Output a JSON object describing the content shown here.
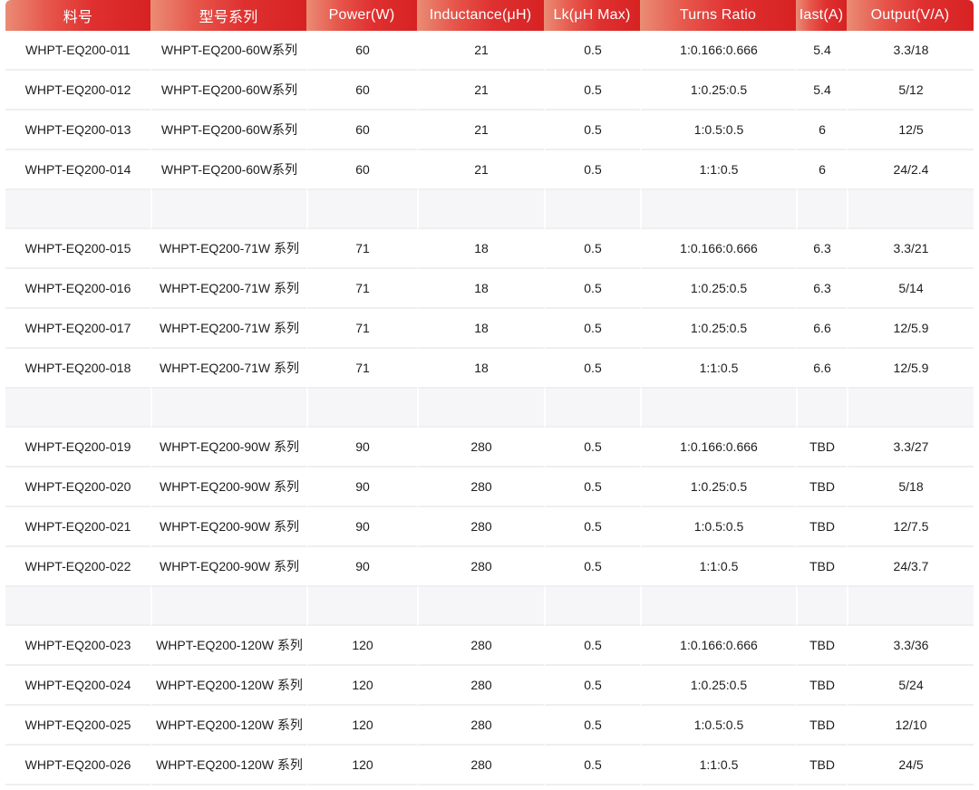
{
  "table": {
    "headers": [
      "料号",
      "型号系列",
      "Power(W)",
      "Inductance(μH)",
      "Lk(μH Max)",
      "Turns Ratio",
      "Iast(A)",
      "Output(V/A)"
    ],
    "rows": [
      [
        "WHPT-EQ200-011",
        "WHPT-EQ200-60W系列",
        "60",
        "21",
        "0.5",
        "1:0.166:0.666",
        "5.4",
        "3.3/18"
      ],
      [
        "WHPT-EQ200-012",
        "WHPT-EQ200-60W系列",
        "60",
        "21",
        "0.5",
        "1:0.25:0.5",
        "5.4",
        "5/12"
      ],
      [
        "WHPT-EQ200-013",
        "WHPT-EQ200-60W系列",
        "60",
        "21",
        "0.5",
        "1:0.5:0.5",
        "6",
        "12/5"
      ],
      [
        "WHPT-EQ200-014",
        "WHPT-EQ200-60W系列",
        "60",
        "21",
        "0.5",
        "1:1:0.5",
        "6",
        "24/2.4"
      ],
      [
        "",
        "",
        "",
        "",
        "",
        "",
        "",
        ""
      ],
      [
        "WHPT-EQ200-015",
        "WHPT-EQ200-71W 系列",
        "71",
        "18",
        "0.5",
        "1:0.166:0.666",
        "6.3",
        "3.3/21"
      ],
      [
        "WHPT-EQ200-016",
        "WHPT-EQ200-71W 系列",
        "71",
        "18",
        "0.5",
        "1:0.25:0.5",
        "6.3",
        "5/14"
      ],
      [
        "WHPT-EQ200-017",
        "WHPT-EQ200-71W 系列",
        "71",
        "18",
        "0.5",
        "1:0.25:0.5",
        "6.6",
        "12/5.9"
      ],
      [
        "WHPT-EQ200-018",
        "WHPT-EQ200-71W 系列",
        "71",
        "18",
        "0.5",
        "1:1:0.5",
        "6.6",
        "12/5.9"
      ],
      [
        "",
        "",
        "",
        "",
        "",
        "",
        "",
        ""
      ],
      [
        "WHPT-EQ200-019",
        "WHPT-EQ200-90W 系列",
        "90",
        "280",
        "0.5",
        "1:0.166:0.666",
        "TBD",
        "3.3/27"
      ],
      [
        "WHPT-EQ200-020",
        "WHPT-EQ200-90W 系列",
        "90",
        "280",
        "0.5",
        "1:0.25:0.5",
        "TBD",
        "5/18"
      ],
      [
        "WHPT-EQ200-021",
        "WHPT-EQ200-90W 系列",
        "90",
        "280",
        "0.5",
        "1:0.5:0.5",
        "TBD",
        "12/7.5"
      ],
      [
        "WHPT-EQ200-022",
        "WHPT-EQ200-90W 系列",
        "90",
        "280",
        "0.5",
        "1:1:0.5",
        "TBD",
        "24/3.7"
      ],
      [
        "",
        "",
        "",
        "",
        "",
        "",
        "",
        ""
      ],
      [
        "WHPT-EQ200-023",
        "WHPT-EQ200-120W 系列",
        "120",
        "280",
        "0.5",
        "1:0.166:0.666",
        "TBD",
        "3.3/36"
      ],
      [
        "WHPT-EQ200-024",
        "WHPT-EQ200-120W 系列",
        "120",
        "280",
        "0.5",
        "1:0.25:0.5",
        "TBD",
        "5/24"
      ],
      [
        "WHPT-EQ200-025",
        "WHPT-EQ200-120W 系列",
        "120",
        "280",
        "0.5",
        "1:0.5:0.5",
        "TBD",
        "12/10"
      ],
      [
        "WHPT-EQ200-026",
        "WHPT-EQ200-120W 系列",
        "120",
        "280",
        "0.5",
        "1:1:0.5",
        "TBD",
        "24/5"
      ]
    ]
  },
  "colors": {
    "header_gradient_start": "#ea8c75",
    "header_gradient_end": "#d72222",
    "header_text": "#ffffff",
    "cell_text": "#1d1d1d",
    "gap_row_background": "#f6f6f8",
    "row_divider": "#eeeff1"
  }
}
